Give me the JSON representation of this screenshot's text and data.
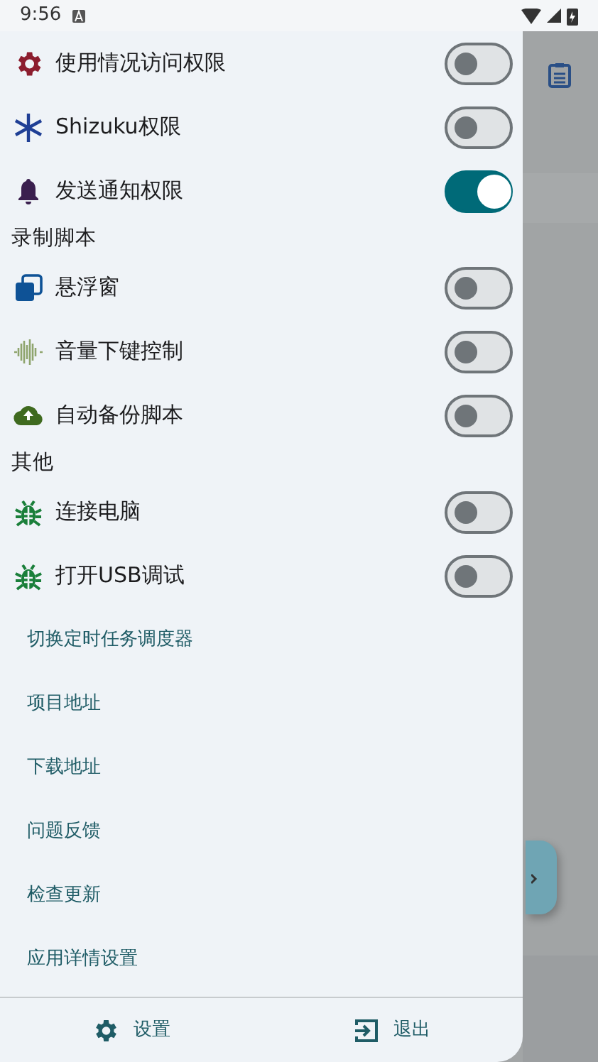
{
  "status_bar": {
    "time": "9:56"
  },
  "drawer": {
    "items": [
      {
        "kind": "switch",
        "label": "使用情况访问权限",
        "on": false
      },
      {
        "kind": "switch",
        "label": "Shizuku权限",
        "on": false
      },
      {
        "kind": "switch",
        "label": "发送通知权限",
        "on": true
      },
      {
        "kind": "header",
        "label": "录制脚本"
      },
      {
        "kind": "switch",
        "label": "悬浮窗",
        "on": false
      },
      {
        "kind": "switch",
        "label": "音量下键控制",
        "on": false
      },
      {
        "kind": "switch",
        "label": "自动备份脚本",
        "on": false
      },
      {
        "kind": "header",
        "label": "其他"
      },
      {
        "kind": "switch",
        "label": "连接电脑",
        "on": false
      },
      {
        "kind": "switch",
        "label": "打开USB调试",
        "on": false
      },
      {
        "kind": "link",
        "label": "切换定时任务调度器"
      },
      {
        "kind": "link",
        "label": "项目地址"
      },
      {
        "kind": "link",
        "label": "下载地址"
      },
      {
        "kind": "link",
        "label": "问题反馈"
      },
      {
        "kind": "link",
        "label": "检查更新"
      },
      {
        "kind": "link",
        "label": "应用详情设置"
      }
    ],
    "footer": [
      {
        "kind": "settings",
        "label": "设置"
      },
      {
        "kind": "exit",
        "label": "退出"
      }
    ]
  }
}
